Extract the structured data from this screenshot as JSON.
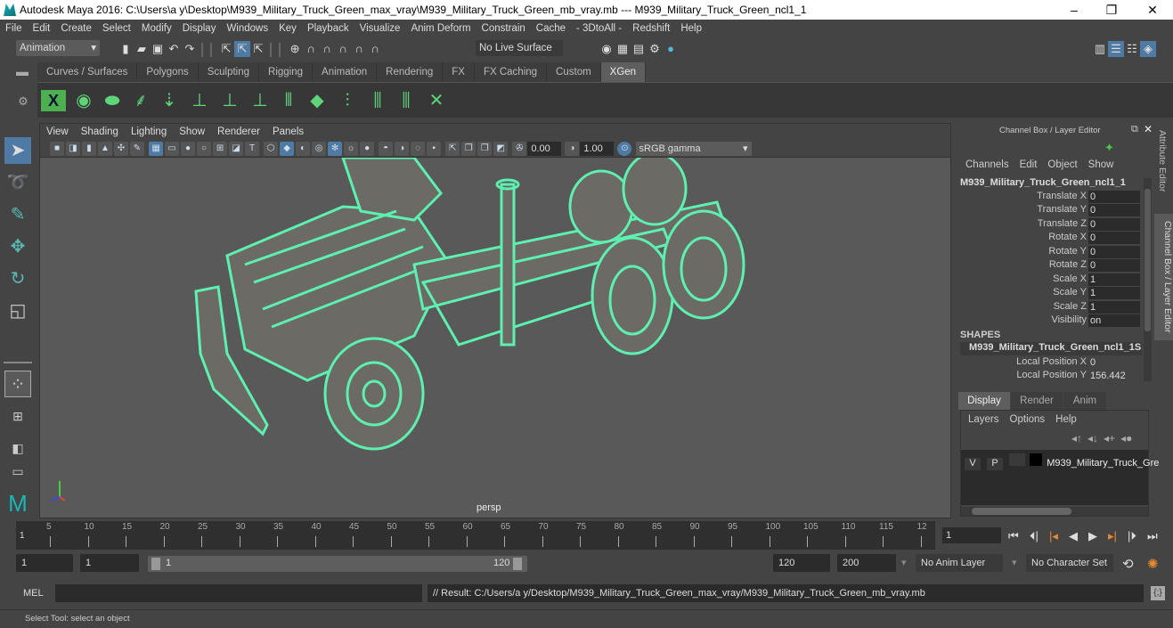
{
  "titlebar": {
    "title": "Autodesk Maya 2016: C:\\Users\\a y\\Desktop\\M939_Military_Truck_Green_max_vray\\M939_Military_Truck_Green_mb_vray.mb   ---   M939_Military_Truck_Green_ncl1_1",
    "minimize": "–",
    "restore": "❐",
    "close": "✕"
  },
  "menubar": [
    "File",
    "Edit",
    "Create",
    "Select",
    "Modify",
    "Display",
    "Windows",
    "Key",
    "Playback",
    "Visualize",
    "Anim Deform",
    "Constrain",
    "Cache",
    "- 3DtoAll -",
    "Redshift",
    "Help"
  ],
  "statusline": {
    "menuset": "Animation",
    "live_surface": "No Live Surface"
  },
  "shelf": {
    "tabs": [
      "Curves / Surfaces",
      "Polygons",
      "Sculpting",
      "Rigging",
      "Animation",
      "Rendering",
      "FX",
      "FX Caching",
      "Custom",
      "XGen"
    ],
    "active_tab": "XGen"
  },
  "viewport": {
    "menu": [
      "View",
      "Shading",
      "Lighting",
      "Show",
      "Renderer",
      "Panels"
    ],
    "exposure": "0.00",
    "gamma": "1.00",
    "color_space": "sRGB gamma",
    "camera_label": "persp",
    "wire_color": "#5ef0b0"
  },
  "channel_box": {
    "title": "Channel Box / Layer Editor",
    "menu": [
      "Channels",
      "Edit",
      "Object",
      "Show"
    ],
    "object_name": "M939_Military_Truck_Green_ncl1_1",
    "channels": [
      {
        "label": "Translate X",
        "value": "0"
      },
      {
        "label": "Translate Y",
        "value": "0"
      },
      {
        "label": "Translate Z",
        "value": "0"
      },
      {
        "label": "Rotate X",
        "value": "0"
      },
      {
        "label": "Rotate Y",
        "value": "0"
      },
      {
        "label": "Rotate Z",
        "value": "0"
      },
      {
        "label": "Scale X",
        "value": "1"
      },
      {
        "label": "Scale Y",
        "value": "1"
      },
      {
        "label": "Scale Z",
        "value": "1"
      },
      {
        "label": "Visibility",
        "value": "on"
      }
    ],
    "shapes_header": "SHAPES",
    "shape_name": "M939_Military_Truck_Green_ncl1_1S...",
    "shape_channels": [
      {
        "label": "Local Position X",
        "value": "0"
      },
      {
        "label": "Local Position Y",
        "value": "156.442"
      }
    ]
  },
  "side_tabs": [
    "Attribute Editor",
    "Channel Box / Layer Editor"
  ],
  "layer_editor": {
    "tabs": [
      "Display",
      "Render",
      "Anim"
    ],
    "active_tab": "Display",
    "menu": [
      "Layers",
      "Options",
      "Help"
    ],
    "layers": [
      {
        "v": "V",
        "p": "P",
        "name": "M939_Military_Truck_Gre"
      }
    ]
  },
  "timeline": {
    "ticks": [
      "5",
      "10",
      "15",
      "20",
      "25",
      "30",
      "35",
      "40",
      "45",
      "50",
      "55",
      "60",
      "65",
      "70",
      "75",
      "80",
      "85",
      "90",
      "95",
      "100",
      "105",
      "110",
      "115",
      "12"
    ],
    "current_frame_marker": "1",
    "current_frame": "1"
  },
  "range": {
    "start": "1",
    "playback_start": "1",
    "slider_start": "1",
    "slider_end": "120",
    "playback_end": "120",
    "end": "200",
    "anim_layer": "No Anim Layer",
    "character_set": "No Character Set"
  },
  "command_line": {
    "lang": "MEL",
    "input": "",
    "result": "// Result: C:/Users/a y/Desktop/M939_Military_Truck_Green_max_vray/M939_Military_Truck_Green_mb_vray.mb"
  },
  "help_line": "Select Tool: select an object"
}
